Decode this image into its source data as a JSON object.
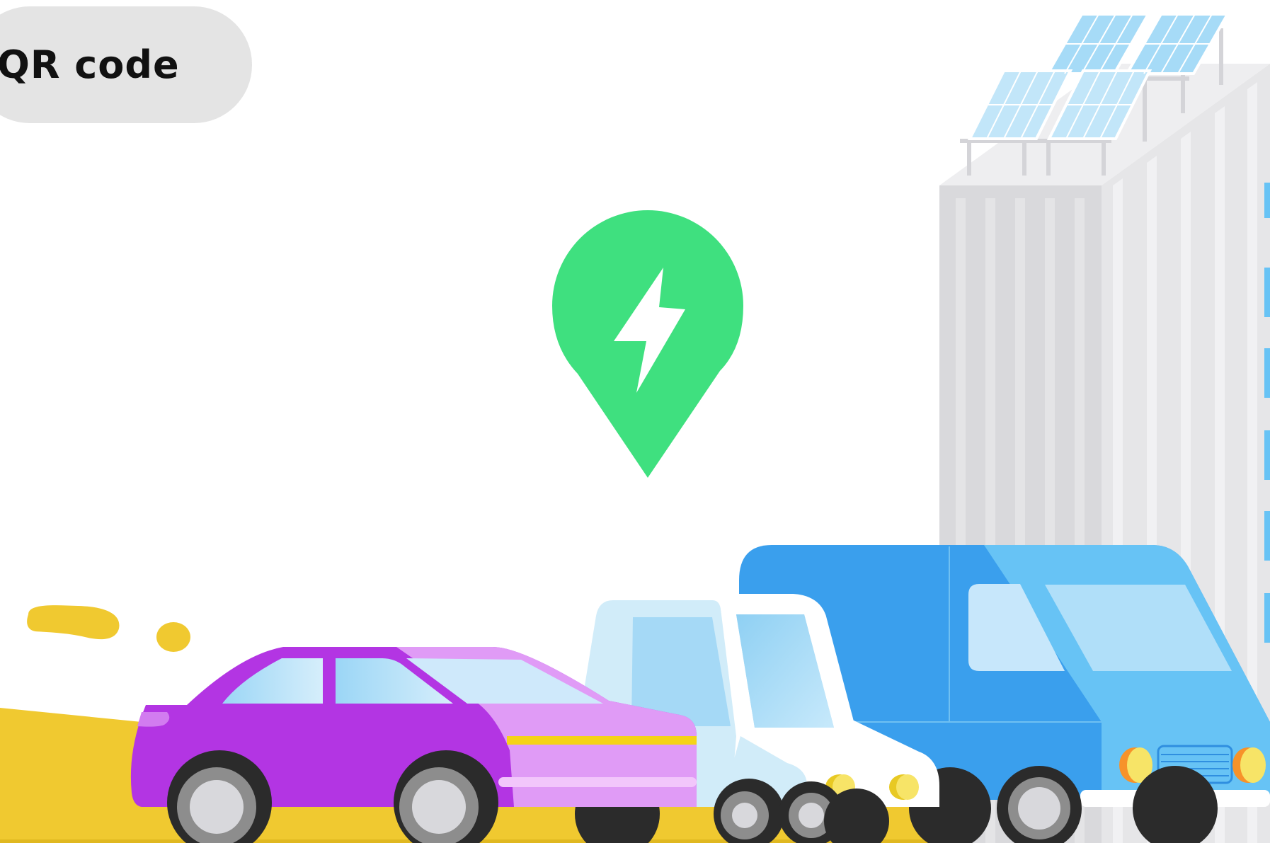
{
  "qr_button": {
    "label": "QR code"
  },
  "marker": {
    "icon": "lightning-bolt-icon",
    "color": "#3fe07f"
  },
  "illustration": {
    "vehicles": [
      "purple-car",
      "light-blue-pickup",
      "blue-van"
    ],
    "building": "building-with-solar-panels",
    "colors": {
      "purple_car": "#b335e3",
      "van": "#3a9fed",
      "road": "#f0c930",
      "building": "#e2e2e4"
    }
  }
}
